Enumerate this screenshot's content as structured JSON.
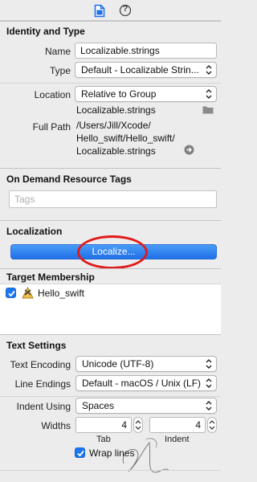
{
  "toolbar": {
    "file_icon": "file-inspector-icon",
    "help_icon": "quick-help-icon",
    "help_glyph": "?"
  },
  "identity": {
    "title": "Identity and Type",
    "name_label": "Name",
    "name_value": "Localizable.strings",
    "type_label": "Type",
    "type_value": "Default - Localizable Strin...",
    "location_label": "Location",
    "location_value": "Relative to Group",
    "location_file": "Localizable.strings",
    "fullpath_label": "Full Path",
    "fullpath_line1": "/Users/Jill/Xcode/",
    "fullpath_line2": "Hello_swift/Hello_swift/",
    "fullpath_line3": "Localizable.strings"
  },
  "odr": {
    "title": "On Demand Resource Tags",
    "tags_placeholder": "Tags"
  },
  "localization": {
    "title": "Localization",
    "button_label": "Localize..."
  },
  "target": {
    "title": "Target Membership",
    "item_label": "Hello_swift",
    "item_checked": true
  },
  "text_settings": {
    "title": "Text Settings",
    "encoding_label": "Text Encoding",
    "encoding_value": "Unicode (UTF-8)",
    "line_endings_label": "Line Endings",
    "line_endings_value": "Default - macOS / Unix (LF)",
    "indent_using_label": "Indent Using",
    "indent_using_value": "Spaces",
    "widths_label": "Widths",
    "tab_value": "4",
    "indent_value": "4",
    "tab_label": "Tab",
    "indent_label": "Indent",
    "wrap_label": "Wrap lines",
    "wrap_checked": true
  },
  "colors": {
    "accent": "#1f6fe8",
    "annotation": "#e21b1b"
  }
}
